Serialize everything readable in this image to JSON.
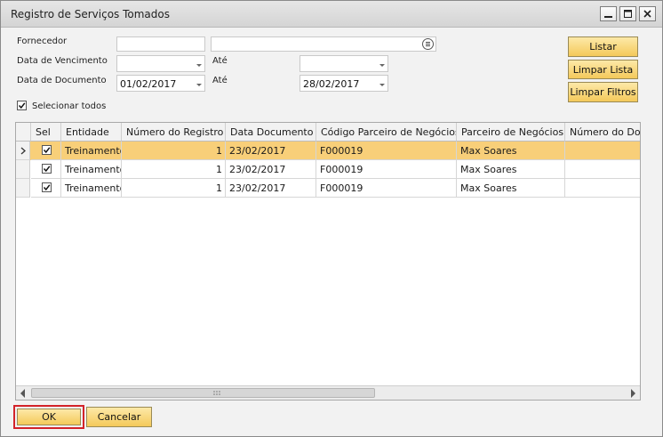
{
  "window": {
    "title": "Registro de Serviços Tomados"
  },
  "form": {
    "fornecedor_label": "Fornecedor",
    "fornecedor_code": "",
    "fornecedor_name": "",
    "vencimento_label": "Data de Vencimento",
    "vencimento_from": "",
    "vencimento_ate_label": "Até",
    "vencimento_to": "",
    "documento_label": "Data de Documento",
    "documento_from": "01/02/2017",
    "documento_ate_label": "Até",
    "documento_to": "28/02/2017",
    "select_all_label": "Selecionar todos",
    "select_all_checked": true
  },
  "buttons": {
    "listar": "Listar",
    "limpar_lista": "Limpar Lista",
    "limpar_filtros": "Limpar Filtros",
    "ok": "OK",
    "cancelar": "Cancelar"
  },
  "table": {
    "columns": [
      "Sel",
      "Entidade",
      "Número do Registro",
      "Data Documento",
      "Código Parceiro de Negócios",
      "Parceiro de Negócios",
      "Número do Docu"
    ],
    "rows": [
      {
        "sel": true,
        "entidade": "Treinamento",
        "numero": "1",
        "data": "23/02/2017",
        "codigo": "F000019",
        "parceiro": "Max Soares",
        "numdoc": ""
      },
      {
        "sel": true,
        "entidade": "Treinamento",
        "numero": "1",
        "data": "23/02/2017",
        "codigo": "F000019",
        "parceiro": "Max Soares",
        "numdoc": ""
      },
      {
        "sel": true,
        "entidade": "Treinamento",
        "numero": "1",
        "data": "23/02/2017",
        "codigo": "F000019",
        "parceiro": "Max Soares",
        "numdoc": ""
      }
    ]
  },
  "colors": {
    "selected_row": "#f8cf79",
    "button_yellow": "#f4c95a",
    "ok_highlight": "#d3232a"
  }
}
